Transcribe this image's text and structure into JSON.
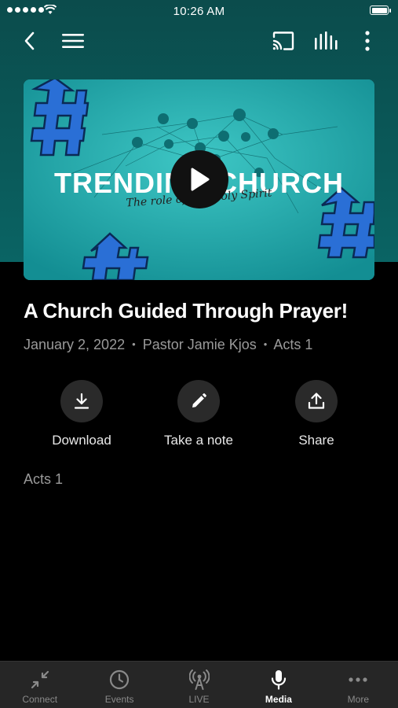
{
  "status_bar": {
    "time": "10:26 AM"
  },
  "nav": {
    "back_icon": "chevron-left-icon",
    "menu_icon": "hamburger-icon",
    "cast_icon": "cast-icon",
    "audio_icon": "audio-levels-icon",
    "more_icon": "vertical-ellipsis-icon"
  },
  "video": {
    "title_text": "TRENDING CHURCH",
    "subtitle_text": "The role of the Holy Spirit",
    "play_icon": "play-icon",
    "accent_color": "#1aa3a6"
  },
  "sermon": {
    "title": "A Church Guided Through Prayer!",
    "date": "January 2, 2022",
    "speaker": "Pastor Jamie Kjos",
    "scripture": "Acts 1",
    "separator": "•"
  },
  "actions": [
    {
      "label": "Download",
      "icon": "download-icon"
    },
    {
      "label": "Take a note",
      "icon": "pencil-icon"
    },
    {
      "label": "Share",
      "icon": "share-icon"
    }
  ],
  "description": "Acts 1",
  "tabs": [
    {
      "label": "Connect",
      "icon": "compress-arrows-icon",
      "active": false
    },
    {
      "label": "Events",
      "icon": "clock-icon",
      "active": false
    },
    {
      "label": "LIVE",
      "icon": "broadcast-tower-icon",
      "active": false
    },
    {
      "label": "Media",
      "icon": "microphone-icon",
      "active": true
    },
    {
      "label": "More",
      "icon": "horizontal-ellipsis-icon",
      "active": false
    }
  ],
  "colors": {
    "header_teal": "#0a5959",
    "tabbar": "#262626",
    "muted_text": "#9a9a9a"
  }
}
